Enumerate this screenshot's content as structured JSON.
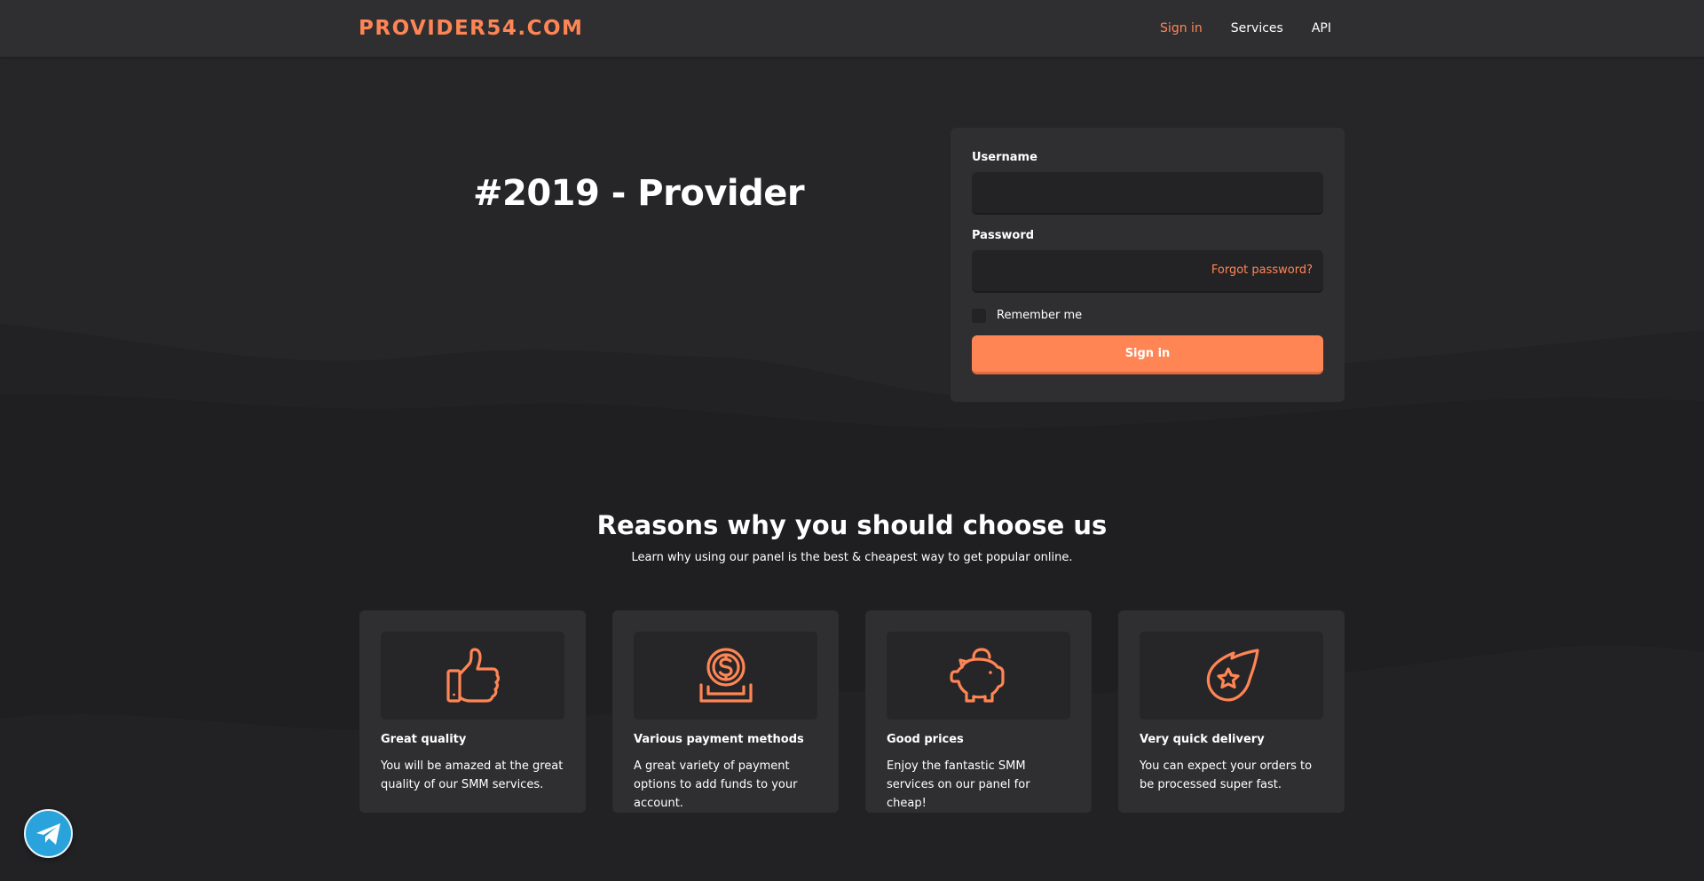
{
  "brand": {
    "name": "PROVIDER54.COM"
  },
  "nav": {
    "items": [
      {
        "label": "Sign in",
        "active": true
      },
      {
        "label": "Services",
        "active": false
      },
      {
        "label": "API",
        "active": false
      }
    ]
  },
  "hero": {
    "title": "#2019 - Provider"
  },
  "login": {
    "username_label": "Username",
    "username_value": "",
    "password_label": "Password",
    "password_value": "",
    "forgot_label": "Forgot password?",
    "remember_label": "Remember me",
    "remember_checked": false,
    "submit_label": "Sign in"
  },
  "reasons": {
    "title": "Reasons why you should choose us",
    "subtitle": "Learn why using our panel is the best & cheapest way to get popular online.",
    "cards": [
      {
        "icon": "thumbs-up-icon",
        "title": "Great quality",
        "text": "You will be amazed at the great quality of our SMM services."
      },
      {
        "icon": "coin-payment-icon",
        "title": "Various payment methods",
        "text": "A great variety of payment options to add funds to your account."
      },
      {
        "icon": "piggy-bank-icon",
        "title": "Good prices",
        "text": "Enjoy the fantastic SMM services on our panel for cheap!"
      },
      {
        "icon": "comet-star-icon",
        "title": "Very quick delivery",
        "text": "You can expect your orders to be processed super fast."
      }
    ]
  },
  "floating": {
    "icon": "telegram-icon"
  },
  "colors": {
    "accent": "#ff8555",
    "background": "#262628",
    "surface": "#2f2f31",
    "input": "#232325",
    "telegram": "#2aa2dc"
  }
}
